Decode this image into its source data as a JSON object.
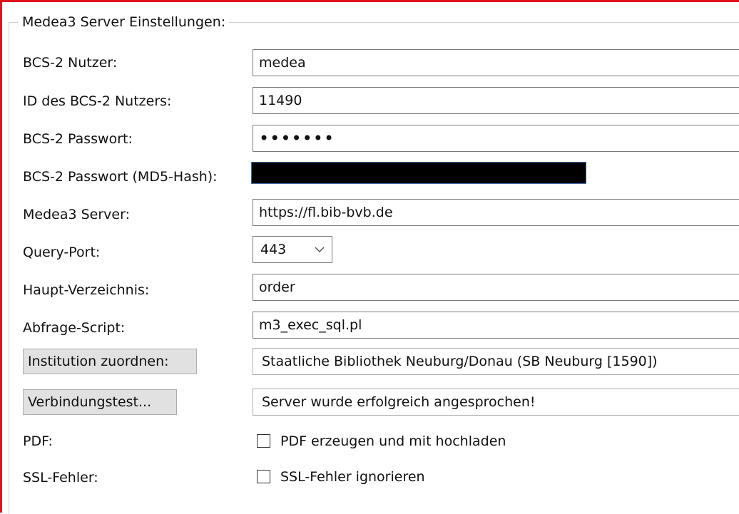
{
  "group": {
    "title": "Medea3 Server Einstellungen:"
  },
  "fields": {
    "bcs_user": {
      "label": "BCS-2 Nutzer:",
      "value": "medea"
    },
    "bcs_user_id": {
      "label": "ID des BCS-2 Nutzers:",
      "value": "11490"
    },
    "bcs_password": {
      "label": "BCS-2 Passwort:",
      "value": "•••••••"
    },
    "bcs_md5": {
      "label": "BCS-2 Passwort (MD5-Hash):",
      "value": ""
    },
    "medea_server": {
      "label": "Medea3 Server:",
      "value": "https://fl.bib-bvb.de"
    },
    "query_port": {
      "label": "Query-Port:",
      "value": "443"
    },
    "main_dir": {
      "label": "Haupt-Verzeichnis:",
      "value": "order"
    },
    "query_script": {
      "label": "Abfrage-Script:",
      "value": "m3_exec_sql.pl"
    }
  },
  "institution": {
    "button_label": "Institution zuordnen:",
    "value": "Staatliche Bibliothek Neuburg/Donau (SB Neuburg [1590])"
  },
  "connection_test": {
    "button_label": "Verbindungstest...",
    "value": "Server wurde erfolgreich angesprochen!"
  },
  "pdf": {
    "label": "PDF:",
    "checkbox_label": "PDF erzeugen und mit hochladen",
    "checked": false
  },
  "ssl": {
    "label": "SSL-Fehler:",
    "checkbox_label": "SSL-Fehler ignorieren",
    "checked": false
  },
  "colors": {
    "frame_border": "#e0141c",
    "button_bg": "#e1e1e1",
    "redaction": "#000000"
  }
}
